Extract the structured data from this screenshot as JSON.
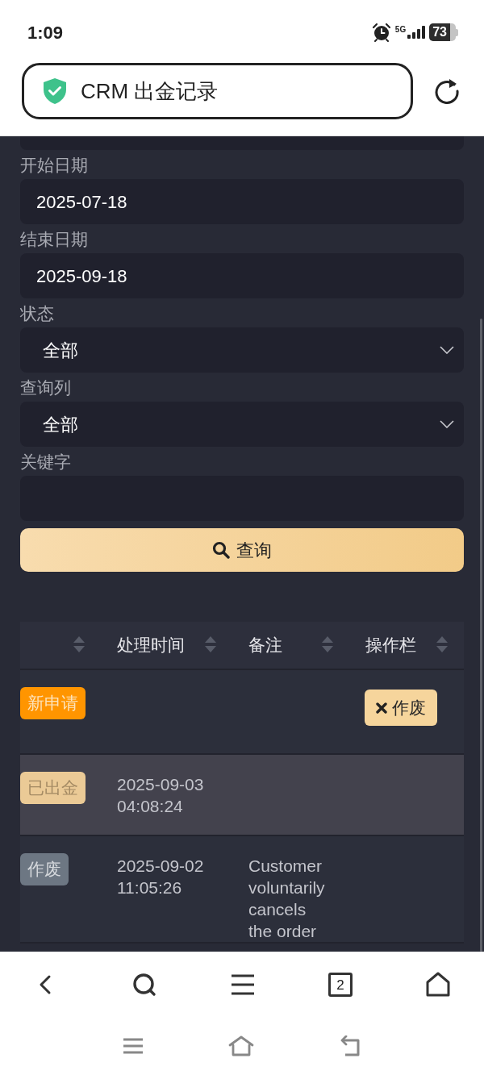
{
  "status_bar": {
    "time": "1:09",
    "network": "5G",
    "battery": "73"
  },
  "browser": {
    "page_title": "CRM 出金记录",
    "tab_count": "2"
  },
  "filters": [
    {
      "kind": "partial"
    },
    {
      "kind": "date",
      "label": "开始日期",
      "value": "2025-07-18"
    },
    {
      "kind": "date",
      "label": "结束日期",
      "value": "2025-09-18"
    },
    {
      "kind": "select",
      "label": "状态",
      "value": "全部"
    },
    {
      "kind": "select",
      "label": "查询列",
      "value": "全部"
    },
    {
      "kind": "text",
      "label": "关键字"
    }
  ],
  "search_button": {
    "label": "查询"
  },
  "table": {
    "columns": [
      {
        "sortable": true
      },
      {
        "label": "处理时间",
        "sortable": true
      },
      {
        "label": "备注",
        "sortable": true
      },
      {
        "label": "操作栏",
        "sortable": true
      }
    ],
    "rows": [
      {
        "selected": false,
        "status": {
          "kind": "new",
          "label": "新申请"
        },
        "action": {
          "label": "作废"
        }
      },
      {
        "selected": true,
        "status": {
          "kind": "paid",
          "label": "已出金"
        },
        "time": "2025-09-03 04:08:24"
      },
      {
        "selected": false,
        "status": {
          "kind": "void",
          "label": "作废"
        },
        "time": "2025-09-02 11:05:26",
        "note": "Customer voluntarily cancels the order"
      }
    ]
  }
}
